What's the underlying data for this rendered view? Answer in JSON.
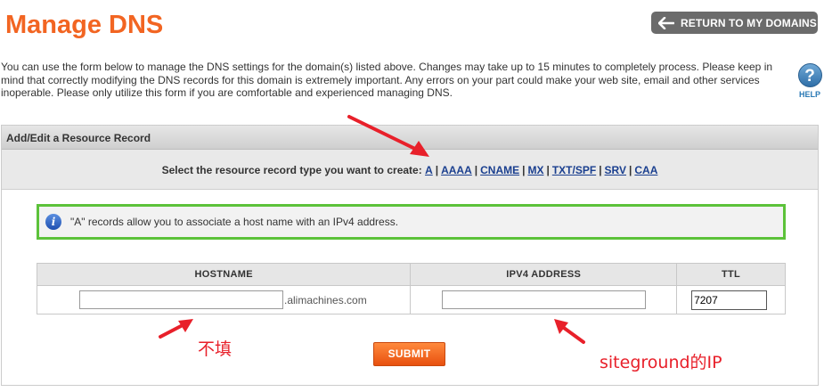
{
  "page_title": "Manage DNS",
  "return_button": {
    "label": "RETURN TO MY DOMAINS",
    "icon": "arrow-left-icon"
  },
  "intro_text": "You can use the form below to manage the DNS settings for the domain(s) listed above. Changes may take up to 15 minutes to completely process. Please keep in mind that correctly modifying the DNS records for this domain is extremely important. Any errors on your part could make your web site, email and other services inoperable. Please only utilize this form if you are comfortable and experienced managing DNS.",
  "help": {
    "label": "HELP",
    "glyph": "?",
    "icon": "help-icon"
  },
  "panel": {
    "header": "Add/Edit a Resource Record",
    "type_prompt": "Select the resource record type you want to create:",
    "record_types": [
      "A",
      "AAAA",
      "CNAME",
      "MX",
      "TXT/SPF",
      "SRV",
      "CAA"
    ],
    "separator": "|"
  },
  "info": {
    "icon_glyph": "i",
    "text": "\"A\" records allow you to associate a host name with an IPv4 address."
  },
  "table": {
    "headers": [
      "HOSTNAME",
      "IPV4 ADDRESS",
      "TTL"
    ],
    "hostname_value": "",
    "hostname_suffix": ".alimachines.com",
    "ip_value": "",
    "ttl_value": "7207"
  },
  "submit_label": "SUBMIT",
  "annotations": {
    "hostname_note": "不填",
    "ip_note": "siteground的IP",
    "color": "#e8202a"
  },
  "colors": {
    "title": "#f26522",
    "accent_green": "#5cc23a",
    "link": "#1a3f8f"
  }
}
